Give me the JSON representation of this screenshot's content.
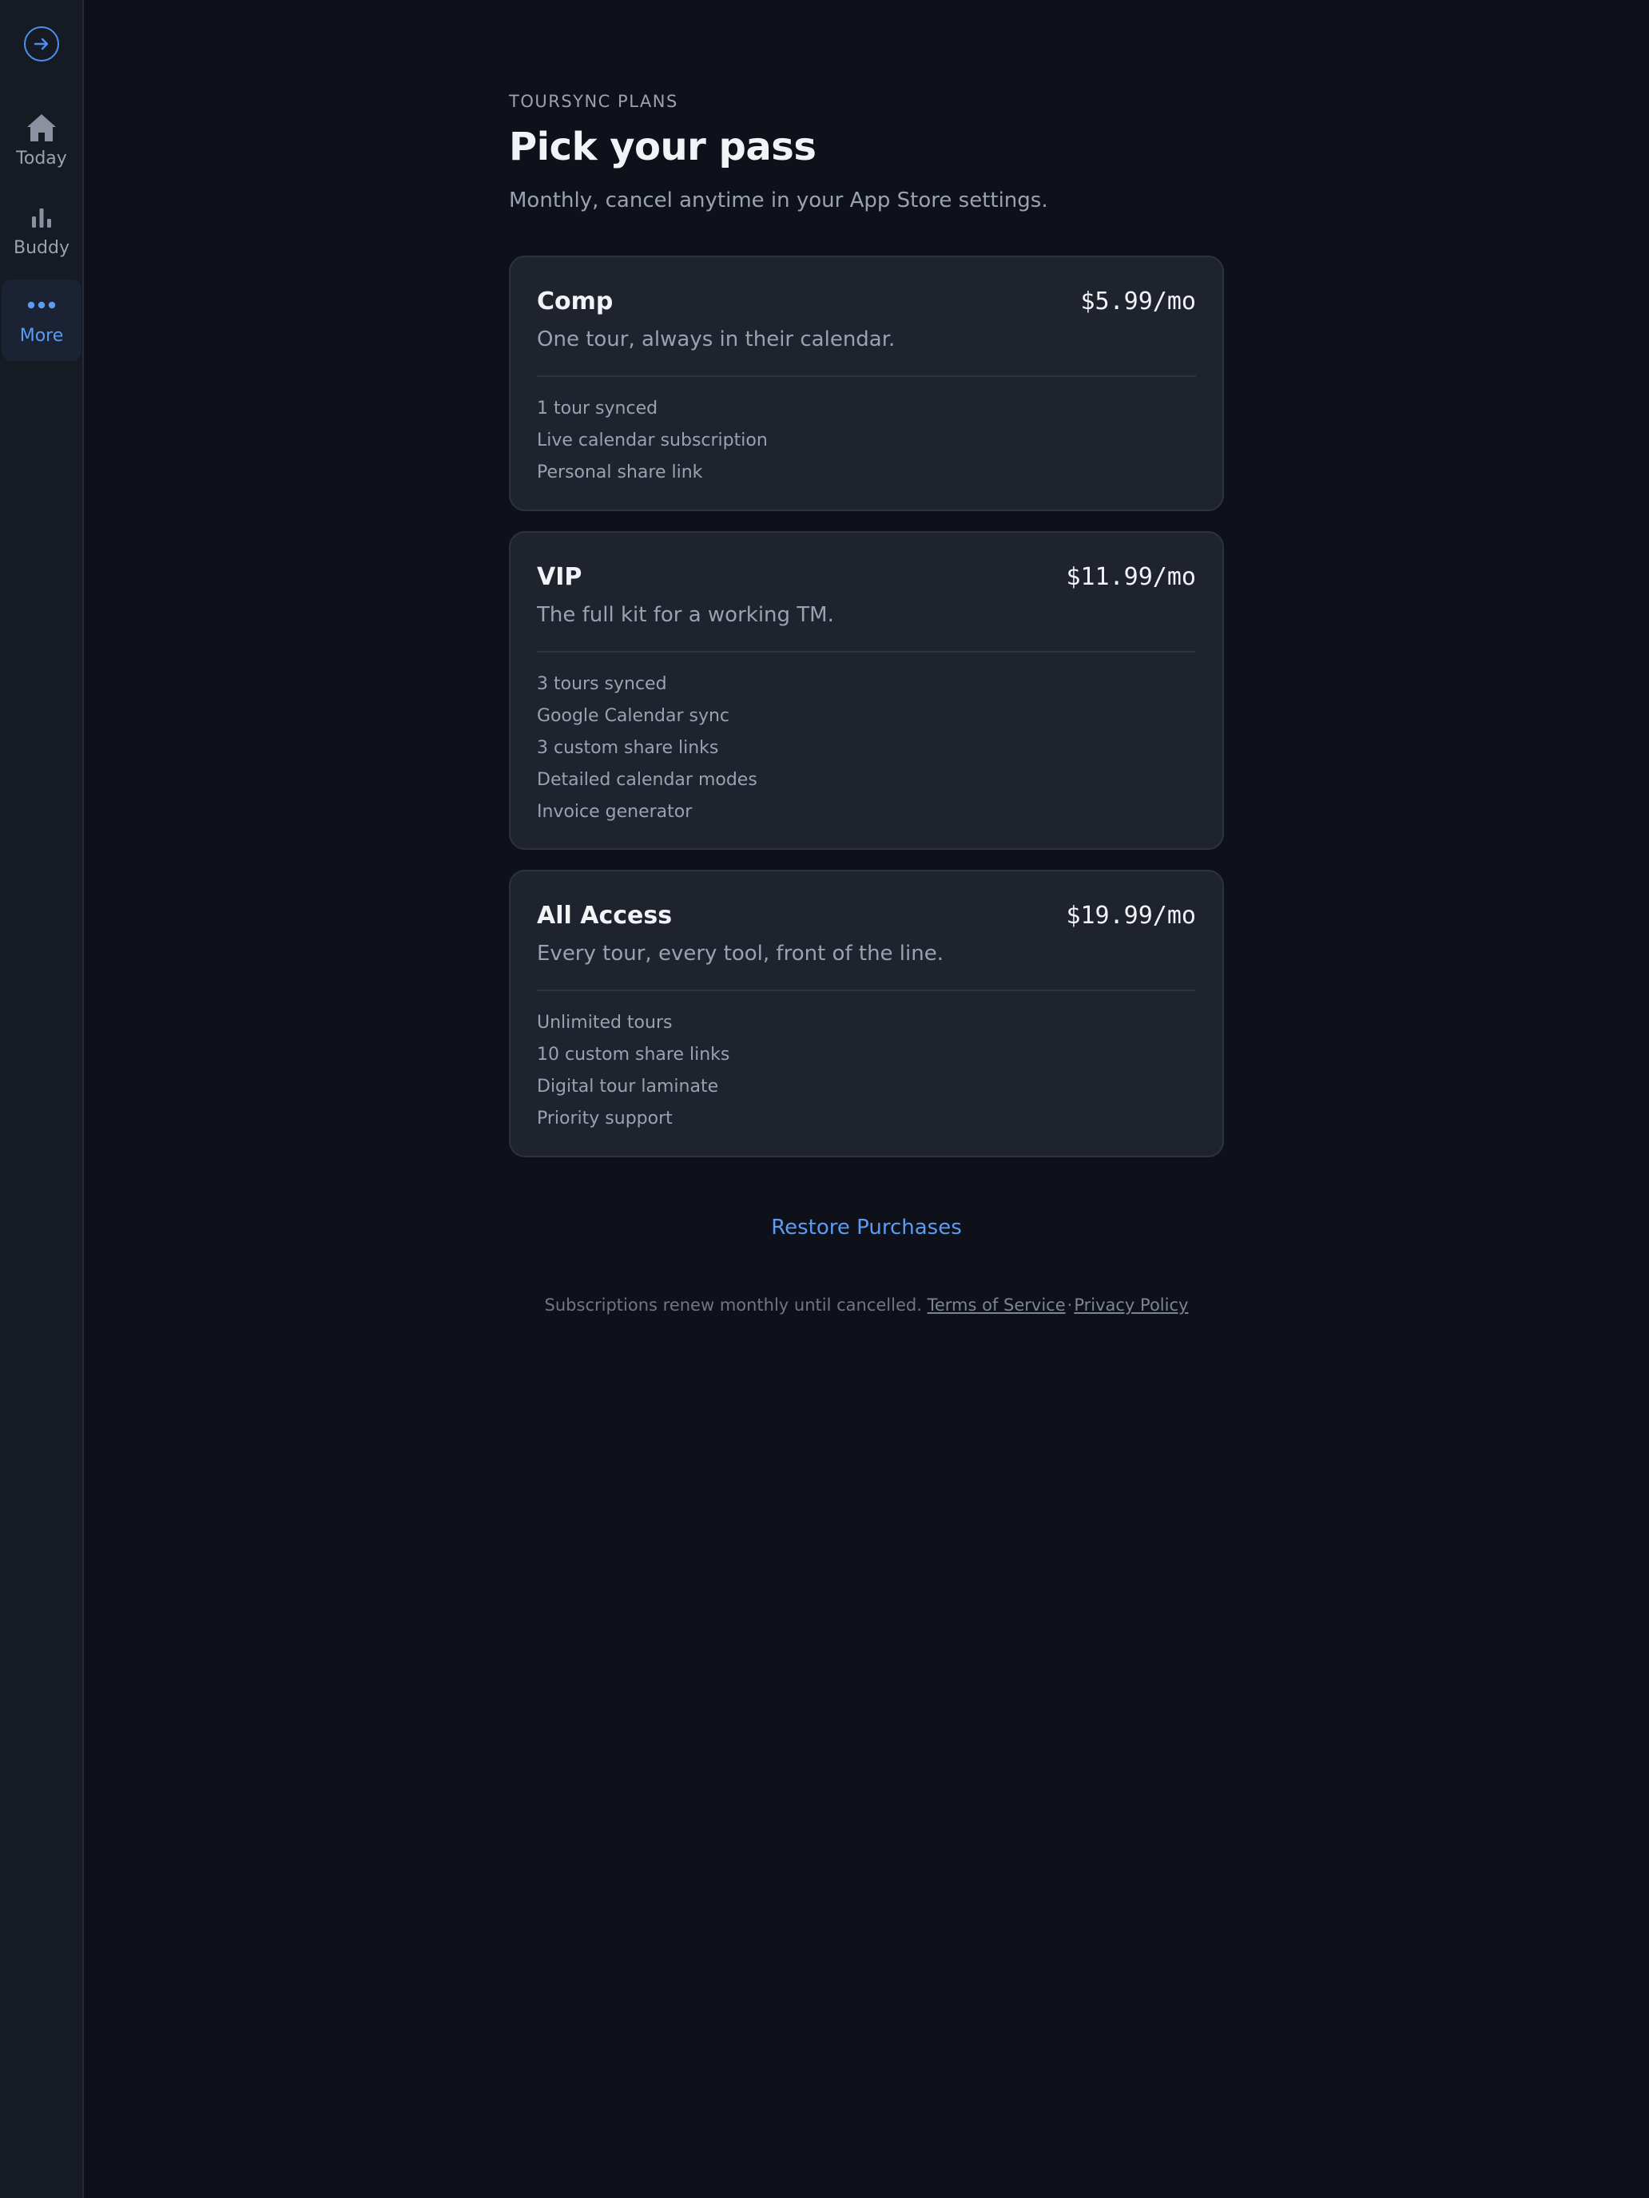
{
  "sidebar": {
    "collapse_icon": "arrow-right-circle-icon",
    "items": [
      {
        "label": "Today",
        "icon": "home-icon",
        "active": false
      },
      {
        "label": "Buddy",
        "icon": "bar-chart-icon",
        "active": false
      },
      {
        "label": "More",
        "icon": "more-dots-icon",
        "active": true
      }
    ]
  },
  "header": {
    "eyebrow": "TOURSYNC PLANS",
    "title": "Pick your pass",
    "subtitle": "Monthly, cancel anytime in your App Store settings."
  },
  "plans": [
    {
      "name": "Comp",
      "price": "$5.99/mo",
      "description": "One tour, always in their calendar.",
      "features": [
        "1 tour synced",
        "Live calendar subscription",
        "Personal share link"
      ]
    },
    {
      "name": "VIP",
      "price": "$11.99/mo",
      "description": "The full kit for a working TM.",
      "features": [
        "3 tours synced",
        "Google Calendar sync",
        "3 custom share links",
        "Detailed calendar modes",
        "Invoice generator"
      ]
    },
    {
      "name": "All Access",
      "price": "$19.99/mo",
      "description": "Every tour, every tool, front of the line.",
      "features": [
        "Unlimited tours",
        "10 custom share links",
        "Digital tour laminate",
        "Priority support"
      ]
    }
  ],
  "restore_label": "Restore Purchases",
  "legal": {
    "text": "Subscriptions renew monthly until cancelled.",
    "terms": "Terms of Service",
    "separator": "·",
    "privacy": "Privacy Policy"
  },
  "colors": {
    "background": "#0e1119",
    "card": "#1e232e",
    "accent": "#5b9cf2",
    "muted_text": "#9aa2b1"
  }
}
